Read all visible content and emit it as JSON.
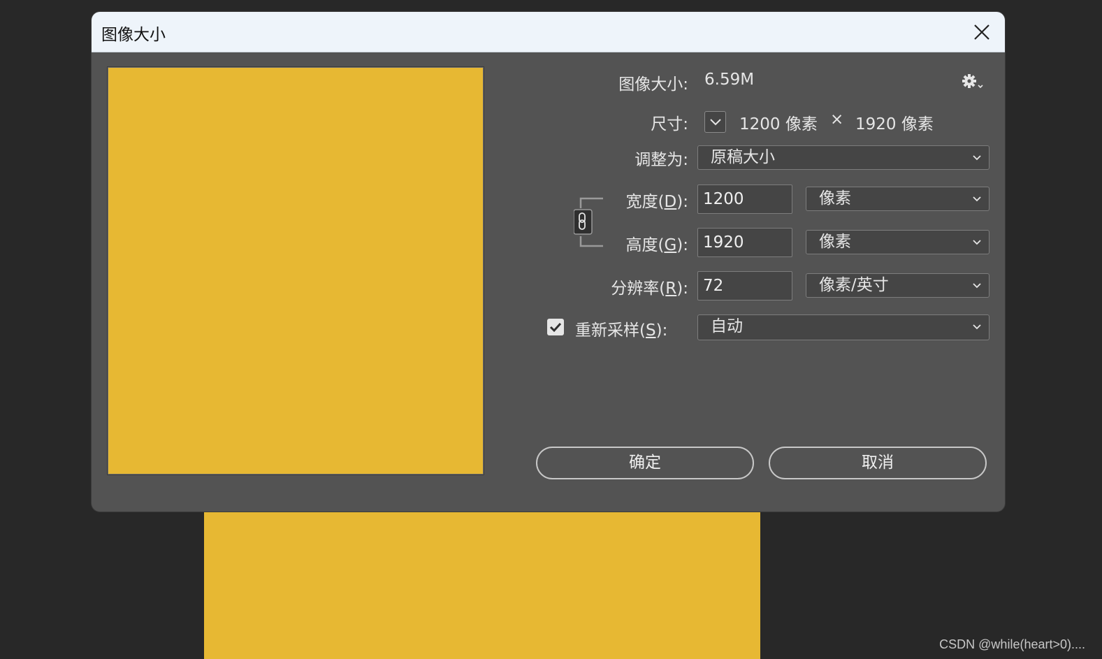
{
  "dialog": {
    "title": "图像大小",
    "image_size_label": "图像大小:",
    "image_size_value": "6.59M",
    "dimensions_label": "尺寸:",
    "dimensions_width": "1200 像素",
    "dimensions_times": "×",
    "dimensions_height": "1920 像素",
    "fit_to_label": "调整为:",
    "fit_to_value": "原稿大小",
    "width_label_pre": "宽度(",
    "width_label_key": "D",
    "width_label_post": "):",
    "width_value": "1200",
    "width_unit": "像素",
    "height_label_pre": "高度(",
    "height_label_key": "G",
    "height_label_post": "):",
    "height_value": "1920",
    "height_unit": "像素",
    "resolution_label_pre": "分辨率(",
    "resolution_label_key": "R",
    "resolution_label_post": "):",
    "resolution_value": "72",
    "resolution_unit": "像素/英寸",
    "resample_label_pre": "重新采样(",
    "resample_label_key": "S",
    "resample_label_post": "):",
    "resample_checked": true,
    "resample_value": "自动",
    "ok_label": "确定",
    "cancel_label": "取消"
  },
  "icons": {
    "close": "close-icon",
    "gear": "gear-icon",
    "chevron": "chevron-down-icon",
    "link": "chain-link-icon",
    "check": "checkmark-icon"
  },
  "colors": {
    "canvas_fill": "#e7b833",
    "dialog_bg": "#535353",
    "app_bg": "#282828",
    "titlebar_bg": "#eef4fa"
  },
  "watermark": "CSDN @while(heart>0)...."
}
